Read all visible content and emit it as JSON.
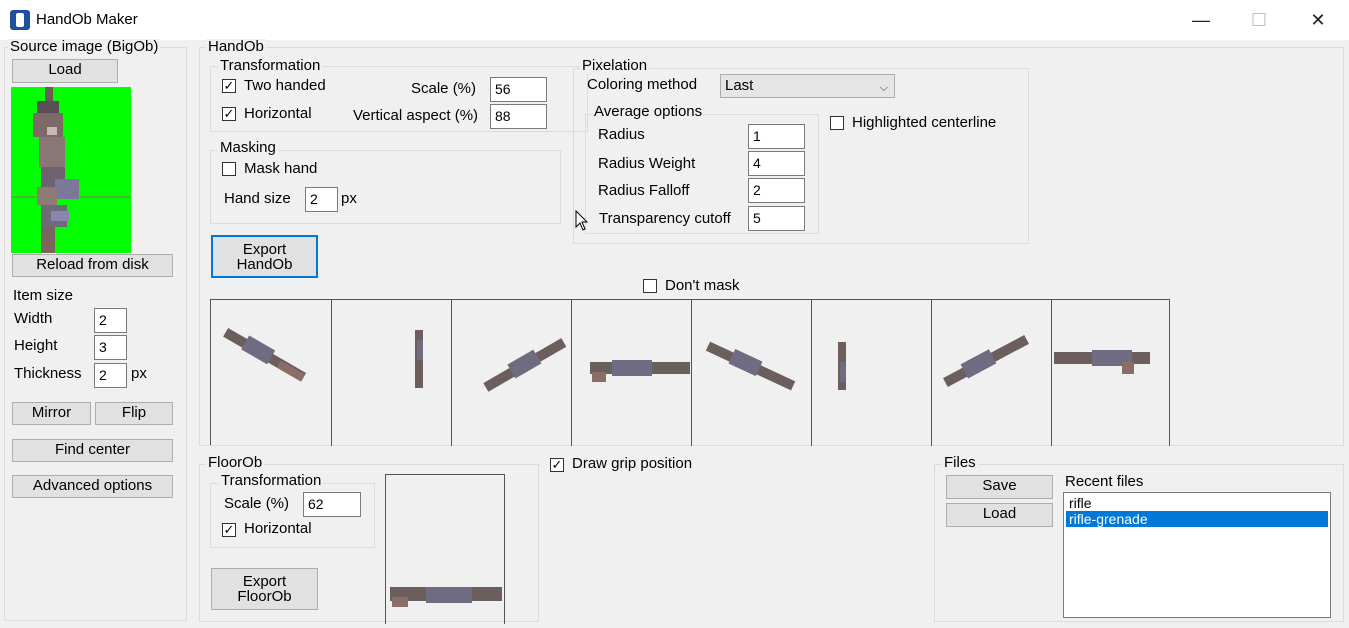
{
  "window": {
    "title": "HandOb Maker",
    "minimize": "—",
    "maximize": "☐",
    "close": "✕"
  },
  "source": {
    "group_label": "Source image (BigOb)",
    "load": "Load",
    "reload": "Reload from disk",
    "item_size": "Item size",
    "width_label": "Width",
    "width_value": "2",
    "height_label": "Height",
    "height_value": "3",
    "thickness_label": "Thickness",
    "thickness_value": "2",
    "thickness_unit": "px",
    "mirror": "Mirror",
    "flip": "Flip",
    "find_center": "Find center",
    "advanced": "Advanced options",
    "bg_color": "#00ff00"
  },
  "handob": {
    "group_label": "HandOb",
    "transformation": {
      "label": "Transformation",
      "two_handed": "Two handed",
      "two_handed_checked": true,
      "horizontal": "Horizontal",
      "horizontal_checked": true,
      "scale_label": "Scale (%)",
      "scale_value": "56",
      "vaspect_label": "Vertical aspect (%)",
      "vaspect_value": "88"
    },
    "masking": {
      "label": "Masking",
      "mask_hand": "Mask hand",
      "mask_hand_checked": false,
      "hand_size_label": "Hand size",
      "hand_size_value": "2",
      "hand_size_unit": "px"
    },
    "pixelation": {
      "label": "Pixelation",
      "coloring_label": "Coloring method",
      "coloring_value": "Last",
      "highlighted": "Highlighted centerline",
      "highlighted_checked": false,
      "average": {
        "label": "Average options",
        "radius_label": "Radius",
        "radius_value": "1",
        "rweight_label": "Radius Weight",
        "rweight_value": "4",
        "rfalloff_label": "Radius Falloff",
        "rfalloff_value": "2",
        "tcutoff_label": "Transparency cutoff",
        "tcutoff_value": "5"
      }
    },
    "export": "Export\nHandOb",
    "dont_mask": "Don't mask",
    "dont_mask_checked": false
  },
  "floorob": {
    "group_label": "FloorOb",
    "transformation_label": "Transformation",
    "scale_label": "Scale (%)",
    "scale_value": "62",
    "horizontal": "Horizontal",
    "horizontal_checked": true,
    "export": "Export\nFloorOb",
    "draw_grip": "Draw grip position",
    "draw_grip_checked": true
  },
  "files": {
    "group_label": "Files",
    "save": "Save",
    "load": "Load",
    "recent_label": "Recent files",
    "recent": [
      "rifle",
      "rifle-grenade"
    ],
    "selected_index": 1
  }
}
